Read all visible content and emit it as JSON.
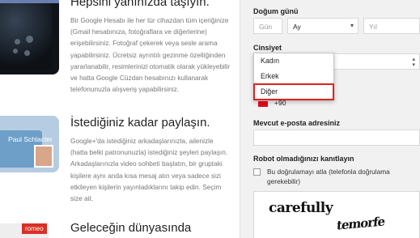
{
  "left": {
    "feature1": {
      "title": "Hepsini yanınızda taşıyın.",
      "body": "Bir Google Hesabı ile her tür cihazdan tüm içeriğinize (Gmail hesabınıza, fotoğraflara ve diğerlerine) erişebilirsiniz. Fotoğraf çekerek veya sesle arama yapabilirsiniz. Ücretsiz ayrıntılı gezinme özelliğinden yararlanabilir, resimlerinizi otomatik olarak yükleyebilir ve hatta Google Cüzdan hesabınızı kullanarak telefonunuzla alışveriş yapabilirsiniz."
    },
    "feature2": {
      "title": "İstediğiniz kadar paylaşın.",
      "body": "Google+'da istediğiniz arkadaşlarınızla, ailenizle (hatta belki patronunuzla) istediğiniz şeyleri paylaşın. Arkadaşlarınızla video sohbeti başlatın, bir gruptaki kişilere aynı anda kısa mesaj atın veya sadece sizi etkileyen kişilerin yayınladıklarını takip edin. Seçim size ait.",
      "card_name": "Paul Schlacter"
    },
    "feature3": {
      "title": "Geleceğin dünyasında",
      "badge": "romeo"
    }
  },
  "form": {
    "birthday": {
      "label": "Doğum günü",
      "day_placeholder": "Gün",
      "month_value": "Ay",
      "year_placeholder": "Yıl"
    },
    "gender": {
      "label": "Cinsiyet",
      "options": [
        "Kadın",
        "Erkek",
        "Diğer"
      ]
    },
    "phone": {
      "code": "+90"
    },
    "email": {
      "label": "Mevcut e-posta adresiniz",
      "value": ""
    },
    "robot": {
      "label": "Robot olmadığınızı kanıtlayın",
      "skip_label": "Bu doğrulamayı atla (telefonla doğrulama gerekebilir)",
      "captcha_word1": "carefully",
      "captcha_word2": "temorfe"
    }
  },
  "icons": {
    "chevron": "chevron-down-icon",
    "updown": "select-arrows-icon"
  },
  "colors": {
    "panel_bg": "#f1f1f1",
    "highlight": "#e02020",
    "badge": "#d93025"
  }
}
